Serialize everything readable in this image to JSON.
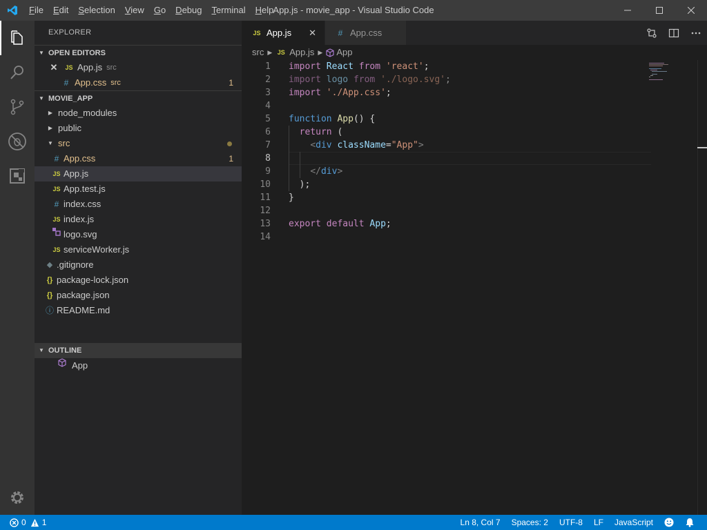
{
  "window": {
    "title": "App.js - movie_app - Visual Studio Code",
    "menu": [
      {
        "label": "File",
        "u": "F",
        "rest": "ile"
      },
      {
        "label": "Edit",
        "u": "E",
        "rest": "dit"
      },
      {
        "label": "Selection",
        "u": "S",
        "rest": "election"
      },
      {
        "label": "View",
        "u": "V",
        "rest": "iew"
      },
      {
        "label": "Go",
        "u": "G",
        "rest": "o"
      },
      {
        "label": "Debug",
        "u": "D",
        "rest": "ebug"
      },
      {
        "label": "Terminal",
        "u": "T",
        "rest": "erminal"
      },
      {
        "label": "Help",
        "u": "H",
        "rest": "elp"
      }
    ]
  },
  "sidebar": {
    "title": "EXPLORER",
    "open_editors": {
      "header": "OPEN EDITORS",
      "items": [
        {
          "icon": "JS",
          "name": "App.js",
          "dir": "src"
        },
        {
          "icon": "#",
          "name": "App.css",
          "dir": "src",
          "badge": "1"
        }
      ]
    },
    "project": {
      "header": "MOVIE_APP",
      "folders": {
        "node_modules": "node_modules",
        "public": "public",
        "src": "src"
      },
      "src_files": [
        {
          "icon": "#",
          "name": "App.css",
          "badge": "1"
        },
        {
          "icon": "JS",
          "name": "App.js"
        },
        {
          "icon": "JS",
          "name": "App.test.js"
        },
        {
          "icon": "#",
          "name": "index.css"
        },
        {
          "icon": "JS",
          "name": "index.js"
        },
        {
          "icon": "svg",
          "name": "logo.svg"
        },
        {
          "icon": "JS",
          "name": "serviceWorker.js"
        }
      ],
      "root_files": [
        {
          "icon": "git",
          "name": ".gitignore"
        },
        {
          "icon": "{}",
          "name": "package-lock.json"
        },
        {
          "icon": "{}",
          "name": "package.json"
        },
        {
          "icon": "i",
          "name": "README.md"
        }
      ]
    },
    "outline": {
      "header": "OUTLINE",
      "items": [
        {
          "name": "App"
        }
      ]
    }
  },
  "editor": {
    "tabs": [
      {
        "icon": "JS",
        "label": "App.js",
        "active": true
      },
      {
        "icon": "#",
        "label": "App.css",
        "active": false
      }
    ],
    "breadcrumbs": [
      "src",
      "App.js",
      "App"
    ],
    "line_numbers": [
      "1",
      "2",
      "3",
      "4",
      "5",
      "6",
      "7",
      "8",
      "9",
      "10",
      "11",
      "12",
      "13",
      "14"
    ],
    "code": {
      "l1": {
        "kw1": "import",
        "id": " React ",
        "kw2": "from",
        "sp": " ",
        "str": "'react'",
        "semi": ";"
      },
      "l2": {
        "kw1": "import",
        "id": " logo ",
        "kw2": "from",
        "sp": " ",
        "str": "'./logo.svg'",
        "semi": ";"
      },
      "l3": {
        "kw1": "import",
        "sp": " ",
        "str": "'./App.css'",
        "semi": ";"
      },
      "l5": {
        "kw": "function",
        "sp": " ",
        "fn": "App",
        "rest": "() {"
      },
      "l6": {
        "indent": "  ",
        "kw": "return",
        "rest": " ("
      },
      "l7": {
        "indent": "    ",
        "open": "<",
        "tag": "div",
        "sp": " ",
        "attr": "className",
        "eq": "=",
        "str": "\"App\"",
        "close": ">"
      },
      "l9": {
        "indent": "    ",
        "open": "</",
        "tag": "div",
        "close": ">"
      },
      "l10": {
        "indent": "  ",
        "text": ");"
      },
      "l11": {
        "text": "}"
      },
      "l13": {
        "kw1": "export",
        "sp1": " ",
        "kw2": "default",
        "sp2": " ",
        "id": "App",
        "semi": ";"
      }
    }
  },
  "statusbar": {
    "errors": "0",
    "warnings": "1",
    "position": "Ln 8, Col 7",
    "spaces": "Spaces: 2",
    "encoding": "UTF-8",
    "eol": "LF",
    "language": "JavaScript"
  },
  "colors": {
    "accent": "#007acc",
    "activity_bar": "#333333",
    "sidebar": "#252526",
    "editor": "#1e1e1e"
  }
}
